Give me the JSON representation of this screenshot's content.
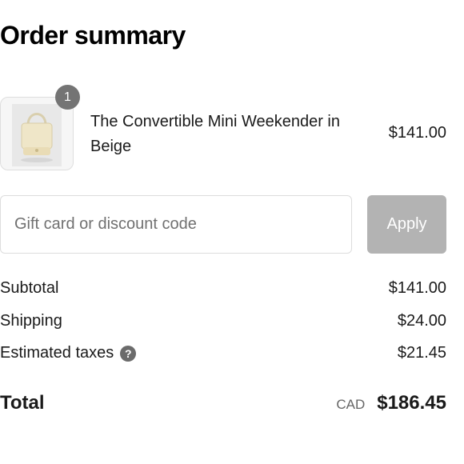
{
  "summary": {
    "title": "Order summary"
  },
  "line_item": {
    "quantity": "1",
    "name": "The Convertible Mini Weekender in Beige",
    "price": "$141.00"
  },
  "discount": {
    "placeholder": "Gift card or discount code",
    "value": "",
    "apply_label": "Apply",
    "apply_disabled": true
  },
  "totals": {
    "subtotal_label": "Subtotal",
    "subtotal_value": "$141.00",
    "shipping_label": "Shipping",
    "shipping_value": "$24.00",
    "taxes_label": "Estimated taxes",
    "taxes_value": "$21.45",
    "total_label": "Total",
    "currency": "CAD",
    "total_value": "$186.45"
  },
  "colors": {
    "apply_disabled_bg": "#b3b3b3",
    "badge_bg": "#747474",
    "text": "#1a1a1a"
  },
  "icons": {
    "help": "question-circle-icon"
  }
}
